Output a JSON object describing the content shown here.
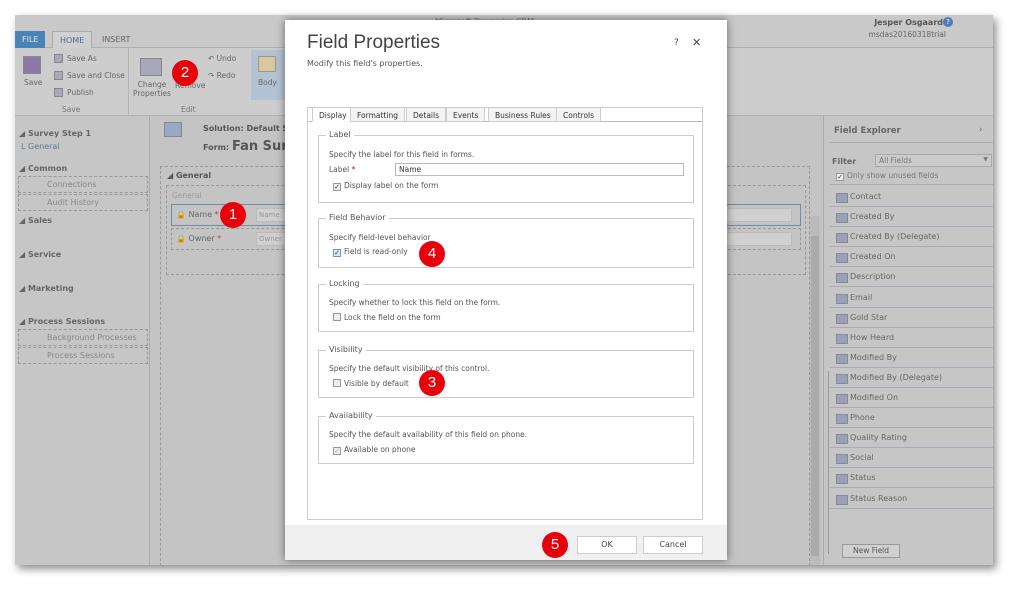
{
  "app": {
    "title": "Microsoft Dynamics CRM",
    "user": "Jesper Osgaard",
    "org": "msdas20160318trial",
    "tabs": [
      "FILE",
      "HOME",
      "INSERT"
    ],
    "ribbon": {
      "save": "Save",
      "save_as": "Save As",
      "save_close": "Save and Close",
      "publish": "Publish",
      "save_group": "Save",
      "change_props": "Change Properties",
      "remove": "Remove",
      "undo": "Undo",
      "redo": "Redo",
      "edit_group": "Edit",
      "body": "Body"
    }
  },
  "leftnav": {
    "step": "Survey Step 1",
    "step_sub": "General",
    "groups": [
      {
        "title": "Common",
        "items": [
          "Connections",
          "Audit History"
        ]
      },
      {
        "title": "Sales",
        "items": []
      },
      {
        "title": "Service",
        "items": []
      },
      {
        "title": "Marketing",
        "items": []
      },
      {
        "title": "Process Sessions",
        "items": [
          "Background Processes",
          "Process Sessions"
        ]
      }
    ]
  },
  "main": {
    "solution": "Solution: Default Solution",
    "form_label": "Form:",
    "form_name": "Fan Survey",
    "section": "General",
    "subsection": "General",
    "fields": [
      "Name",
      "Owner"
    ],
    "placeholders": [
      "Name",
      "Owner"
    ]
  },
  "field_explorer": {
    "title": "Field Explorer",
    "filter_label": "Filter",
    "filter_value": "All Fields",
    "only_unused": "Only show unused fields",
    "only_unused_checked": true,
    "items": [
      "Contact",
      "Created By",
      "Created By (Delegate)",
      "Created On",
      "Description",
      "Email",
      "Gold Star",
      "How Heard",
      "Modified By",
      "Modified By (Delegate)",
      "Modified On",
      "Phone",
      "Quality Rating",
      "Social",
      "Status",
      "Status Reason"
    ],
    "new_field": "New Field"
  },
  "dialog": {
    "title": "Field Properties",
    "subtitle": "Modify this field's properties.",
    "help": "?",
    "close": "✕",
    "tabs": [
      "Display",
      "Formatting",
      "Details",
      "Events",
      "Business Rules",
      "Controls"
    ],
    "active_tab": "Display",
    "label_section": {
      "title": "Label",
      "desc": "Specify the label for this field in forms.",
      "label": "Label",
      "label_value": "Name",
      "display_label": "Display label on the form",
      "display_label_checked": true
    },
    "behavior": {
      "title": "Field Behavior",
      "desc": "Specify field-level behavior",
      "readonly": "Field is read-only",
      "readonly_checked": true
    },
    "locking": {
      "title": "Locking",
      "desc": "Specify whether to lock this field on the form.",
      "lock": "Lock the field on the form",
      "lock_checked": false
    },
    "visibility": {
      "title": "Visibility",
      "desc": "Specify the default visibility of this control.",
      "visible": "Visible by default",
      "visible_checked": false
    },
    "availability": {
      "title": "Availability",
      "desc": "Specify the default availability of this field on phone.",
      "phone": "Available on phone",
      "phone_checked": true
    },
    "ok": "OK",
    "cancel": "Cancel"
  },
  "badges": [
    "1",
    "2",
    "3",
    "4",
    "5"
  ],
  "colors": {
    "badge": "#e8000b",
    "file_tab": "#4a83b6"
  }
}
